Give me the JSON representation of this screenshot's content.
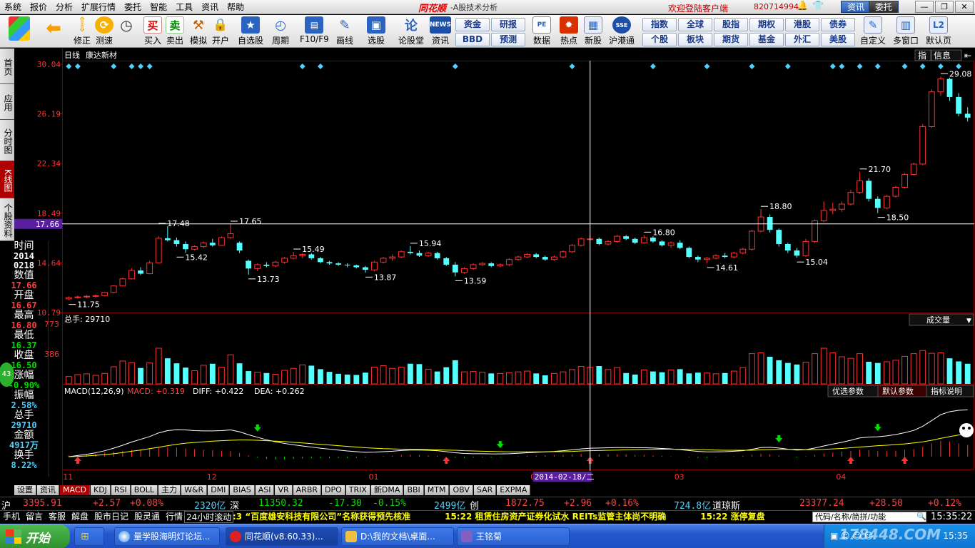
{
  "menubar": {
    "items": [
      "系统",
      "报价",
      "分析",
      "扩展行情",
      "委托",
      "智能",
      "工具",
      "资讯",
      "帮助"
    ],
    "app_logo": "同花顺",
    "app_subtitle": "-A股技术分析",
    "welcome": "欢迎登陆客户端",
    "account": "820714994",
    "btn_news": "资讯",
    "btn_trade": "委托"
  },
  "toolbar": {
    "buttons": [
      "修正",
      "测速",
      "买入",
      "卖出",
      "模拟",
      "开户",
      "自选股",
      "周期",
      "F10/F9",
      "画线",
      "选股",
      "论股堂",
      "资讯",
      "数据",
      "热点",
      "新股",
      "沪港通",
      "自定义",
      "多窗口",
      "默认页"
    ],
    "icon_buy": "买",
    "icon_sell": "卖",
    "icon_news": "NEWS",
    "grid_buttons_a": [
      "资金",
      "研报",
      "BBD",
      "预测"
    ],
    "grid_buttons_b": [
      "指数",
      "全球",
      "股指",
      "期权",
      "港股",
      "债券",
      "个股",
      "板块",
      "期货",
      "基金",
      "外汇",
      "美股"
    ]
  },
  "sidebar": {
    "tabs": [
      "首页",
      "应用",
      "分时图",
      "K线图",
      "个股资料"
    ]
  },
  "info_panel": {
    "time_label": "时间",
    "time_year": "2014",
    "time_date": "0218",
    "value_label": "数值",
    "value": "17.66",
    "open_label": "开盘",
    "open": "16.67",
    "high_label": "最高",
    "high": "16.80",
    "low_label": "最低",
    "low": "16.37",
    "close_label": "收盘",
    "close": "16.50",
    "change_label": "涨幅",
    "change": "-0.90%",
    "amplitude_label": "振幅",
    "amplitude": "2.58%",
    "volume_label": "总手",
    "volume": "29710",
    "amount_label": "金额",
    "amount": "4917万",
    "turnover_label": "换手",
    "turnover": "8.22%",
    "bubble": "43"
  },
  "chart": {
    "period_label": "日线",
    "stock_name": "康达新材",
    "right_btn_a": "指",
    "right_btn_b": "信息",
    "price_ticks": [
      "30.04",
      "26.19",
      "22.34",
      "18.49",
      "17.66",
      "14.64",
      "10.79"
    ],
    "price_annotations": [
      {
        "idx": 0,
        "v": 11.75,
        "label": "11.75",
        "side": "low"
      },
      {
        "idx": 10,
        "v": 17.48,
        "label": "17.48",
        "side": "high"
      },
      {
        "idx": 12,
        "v": 15.42,
        "label": "15.42",
        "side": "low"
      },
      {
        "idx": 18,
        "v": 17.65,
        "label": "17.65",
        "side": "high"
      },
      {
        "idx": 20,
        "v": 13.73,
        "label": "13.73",
        "side": "low"
      },
      {
        "idx": 25,
        "v": 15.49,
        "label": "15.49",
        "side": "high"
      },
      {
        "idx": 33,
        "v": 13.87,
        "label": "13.87",
        "side": "low"
      },
      {
        "idx": 38,
        "v": 15.94,
        "label": "15.94",
        "side": "high"
      },
      {
        "idx": 43,
        "v": 13.59,
        "label": "13.59",
        "side": "low"
      },
      {
        "idx": 64,
        "v": 16.8,
        "label": "16.80",
        "side": "high"
      },
      {
        "idx": 71,
        "v": 14.61,
        "label": "14.61",
        "side": "low"
      },
      {
        "idx": 77,
        "v": 18.8,
        "label": "18.80",
        "side": "high"
      },
      {
        "idx": 81,
        "v": 15.04,
        "label": "15.04",
        "side": "low"
      },
      {
        "idx": 88,
        "v": 21.7,
        "label": "21.70",
        "side": "high"
      },
      {
        "idx": 90,
        "v": 18.5,
        "label": "18.50",
        "side": "low"
      },
      {
        "idx": 97,
        "v": 29.08,
        "label": "29.08",
        "side": "high"
      }
    ],
    "volume_label": "总手: 29710",
    "volume_ticks": [
      "773",
      "386"
    ],
    "volume_select": "成交量",
    "macd_label": "MACD(12,26,9)",
    "macd_value": "MACD: +0.319",
    "diff_value": "DIFF: +0.422",
    "dea_value": "DEA: +0.262",
    "macd_btn_a": "优选参数",
    "macd_btn_b": "默认参数",
    "macd_btn_c": "指标说明",
    "month_labels": [
      {
        "idx": 0,
        "t": "11"
      },
      {
        "idx": 16,
        "t": "12"
      },
      {
        "idx": 34,
        "t": "01"
      },
      {
        "idx": 52,
        "t": "02"
      },
      {
        "idx": 68,
        "t": "03"
      },
      {
        "idx": 86,
        "t": "04"
      }
    ],
    "crosshair_date": "2014-02-18/二",
    "crosshair_price": "17.66",
    "crosshair_idx": 58
  },
  "chart_data": {
    "type": "candlestick",
    "title": "康达新材",
    "ylim": [
      10.79,
      30.04
    ],
    "volume_ylim": [
      0,
      773
    ],
    "ohlc": [
      [
        11.85,
        12.05,
        11.75,
        11.95
      ],
      [
        11.95,
        12.1,
        11.85,
        12.0
      ],
      [
        12.0,
        12.15,
        11.9,
        12.05
      ],
      [
        12.05,
        12.2,
        11.95,
        12.1
      ],
      [
        12.1,
        12.4,
        12.05,
        12.35
      ],
      [
        12.35,
        12.9,
        12.3,
        12.85
      ],
      [
        12.85,
        13.5,
        12.8,
        13.4
      ],
      [
        13.4,
        14.2,
        13.35,
        14.05
      ],
      [
        14.05,
        14.3,
        13.7,
        13.8
      ],
      [
        13.8,
        14.8,
        13.75,
        14.65
      ],
      [
        14.65,
        16.7,
        14.6,
        16.55
      ],
      [
        16.55,
        17.48,
        16.3,
        16.4
      ],
      [
        16.4,
        16.6,
        15.9,
        16.1
      ],
      [
        16.1,
        16.3,
        15.42,
        15.7
      ],
      [
        15.7,
        16.0,
        15.6,
        15.9
      ],
      [
        15.9,
        16.3,
        15.8,
        16.2
      ],
      [
        16.2,
        16.5,
        15.9,
        16.0
      ],
      [
        16.0,
        16.7,
        15.95,
        16.6
      ],
      [
        16.6,
        17.65,
        16.5,
        16.9
      ],
      [
        16.2,
        16.3,
        15.4,
        15.6
      ],
      [
        14.8,
        14.9,
        13.73,
        14.2
      ],
      [
        14.2,
        14.6,
        14.0,
        14.5
      ],
      [
        14.5,
        14.7,
        14.3,
        14.4
      ],
      [
        14.4,
        14.8,
        14.3,
        14.7
      ],
      [
        14.7,
        15.1,
        14.6,
        15.0
      ],
      [
        15.0,
        15.49,
        14.9,
        15.2
      ],
      [
        15.2,
        15.4,
        15.0,
        15.3
      ],
      [
        15.3,
        15.4,
        14.9,
        15.0
      ],
      [
        15.0,
        15.1,
        14.6,
        14.7
      ],
      [
        14.7,
        14.8,
        14.5,
        14.6
      ],
      [
        14.6,
        14.7,
        14.4,
        14.5
      ],
      [
        14.5,
        14.6,
        14.3,
        14.45
      ],
      [
        14.45,
        14.5,
        14.2,
        14.3
      ],
      [
        14.3,
        14.4,
        13.87,
        14.1
      ],
      [
        14.1,
        14.8,
        14.0,
        14.7
      ],
      [
        14.7,
        15.1,
        14.6,
        15.0
      ],
      [
        15.0,
        15.3,
        14.8,
        15.1
      ],
      [
        15.1,
        15.6,
        15.0,
        15.5
      ],
      [
        15.5,
        15.94,
        15.3,
        15.4
      ],
      [
        15.4,
        15.6,
        15.1,
        15.2
      ],
      [
        15.2,
        15.5,
        15.1,
        15.4
      ],
      [
        15.4,
        15.5,
        14.9,
        15.0
      ],
      [
        15.0,
        15.1,
        14.4,
        14.5
      ],
      [
        14.5,
        14.7,
        13.59,
        13.9
      ],
      [
        13.9,
        14.3,
        13.8,
        14.2
      ],
      [
        14.2,
        14.6,
        14.1,
        14.5
      ],
      [
        14.5,
        14.7,
        14.4,
        14.6
      ],
      [
        14.6,
        14.7,
        14.3,
        14.4
      ],
      [
        14.4,
        14.6,
        14.3,
        14.5
      ],
      [
        14.5,
        15.0,
        14.4,
        14.9
      ],
      [
        14.9,
        15.2,
        14.8,
        15.1
      ],
      [
        15.1,
        15.4,
        15.0,
        15.3
      ],
      [
        15.3,
        15.4,
        15.0,
        15.1
      ],
      [
        15.1,
        15.2,
        14.8,
        14.9
      ],
      [
        14.9,
        15.2,
        14.8,
        15.1
      ],
      [
        15.1,
        15.6,
        15.0,
        15.5
      ],
      [
        15.5,
        16.1,
        15.4,
        16.0
      ],
      [
        16.0,
        16.6,
        15.9,
        16.5
      ],
      [
        16.5,
        16.8,
        16.37,
        16.5
      ],
      [
        16.5,
        16.6,
        16.0,
        16.1
      ],
      [
        16.1,
        16.4,
        16.0,
        16.3
      ],
      [
        16.3,
        16.8,
        16.2,
        16.7
      ],
      [
        16.7,
        16.8,
        16.4,
        16.5
      ],
      [
        16.5,
        16.6,
        16.1,
        16.2
      ],
      [
        16.2,
        16.8,
        16.1,
        16.6
      ],
      [
        16.6,
        16.7,
        16.2,
        16.3
      ],
      [
        16.3,
        16.4,
        15.9,
        16.0
      ],
      [
        16.0,
        16.3,
        15.8,
        16.2
      ],
      [
        16.2,
        16.4,
        15.7,
        15.8
      ],
      [
        15.8,
        15.9,
        15.0,
        15.1
      ],
      [
        15.1,
        15.2,
        14.7,
        14.9
      ],
      [
        14.9,
        15.1,
        14.61,
        15.0
      ],
      [
        15.0,
        15.3,
        14.9,
        15.2
      ],
      [
        15.2,
        15.4,
        15.0,
        15.1
      ],
      [
        15.1,
        15.5,
        15.0,
        15.4
      ],
      [
        15.4,
        15.8,
        15.3,
        15.7
      ],
      [
        15.7,
        17.2,
        15.6,
        17.1
      ],
      [
        17.1,
        18.8,
        17.0,
        18.2
      ],
      [
        18.2,
        18.4,
        17.0,
        17.2
      ],
      [
        17.2,
        17.3,
        15.9,
        16.1
      ],
      [
        16.1,
        16.2,
        15.4,
        15.6
      ],
      [
        15.6,
        15.8,
        15.04,
        15.2
      ],
      [
        15.2,
        16.5,
        15.1,
        16.3
      ],
      [
        16.3,
        18.0,
        16.2,
        17.9
      ],
      [
        17.9,
        19.4,
        17.8,
        18.7
      ],
      [
        18.7,
        19.3,
        18.4,
        18.8
      ],
      [
        18.8,
        19.4,
        18.6,
        19.2
      ],
      [
        19.2,
        20.3,
        19.1,
        20.1
      ],
      [
        20.1,
        21.7,
        20.0,
        21.0
      ],
      [
        21.0,
        21.2,
        19.4,
        19.6
      ],
      [
        19.6,
        19.8,
        18.5,
        18.9
      ],
      [
        18.9,
        19.9,
        18.8,
        19.8
      ],
      [
        19.8,
        20.6,
        19.7,
        20.5
      ],
      [
        20.5,
        21.6,
        20.4,
        21.5
      ],
      [
        21.5,
        22.4,
        21.4,
        22.3
      ],
      [
        22.3,
        25.4,
        22.2,
        25.2
      ],
      [
        25.2,
        28.1,
        25.1,
        27.9
      ],
      [
        27.9,
        29.08,
        27.6,
        28.9
      ],
      [
        28.9,
        29.0,
        27.2,
        27.5
      ],
      [
        27.5,
        27.8,
        26.0,
        26.2
      ],
      [
        26.2,
        26.7,
        25.6,
        25.9
      ]
    ],
    "volume": [
      95,
      120,
      130,
      110,
      135,
      220,
      295,
      275,
      205,
      270,
      460,
      330,
      265,
      210,
      170,
      240,
      260,
      215,
      375,
      265,
      165,
      150,
      140,
      125,
      175,
      200,
      245,
      235,
      190,
      155,
      130,
      120,
      115,
      145,
      215,
      235,
      200,
      215,
      260,
      255,
      190,
      160,
      215,
      305,
      155,
      160,
      150,
      135,
      135,
      145,
      155,
      165,
      135,
      110,
      135,
      155,
      185,
      225,
      215,
      230,
      185,
      210,
      140,
      120,
      180,
      160,
      150,
      180,
      190,
      135,
      145,
      140,
      130,
      140,
      165,
      210,
      390,
      400,
      350,
      305,
      270,
      250,
      280,
      390,
      460,
      400,
      350,
      330,
      390,
      285,
      270,
      285,
      305,
      355,
      390,
      430,
      395,
      400,
      330,
      290,
      260
    ],
    "macd_hist": [
      0.05,
      0.07,
      0.1,
      0.14,
      0.18,
      0.22,
      0.26,
      0.3,
      0.32,
      0.34,
      0.4,
      0.42,
      0.4,
      0.36,
      0.33,
      0.3,
      0.28,
      0.26,
      0.24,
      0.16,
      0.06,
      -0.04,
      -0.1,
      -0.12,
      -0.12,
      -0.1,
      -0.08,
      -0.07,
      -0.07,
      -0.07,
      -0.06,
      -0.06,
      -0.05,
      -0.04,
      0.0,
      0.03,
      0.05,
      0.07,
      0.08,
      0.08,
      0.06,
      0.04,
      0.0,
      -0.04,
      -0.05,
      -0.04,
      -0.03,
      -0.03,
      -0.02,
      0.0,
      0.02,
      0.04,
      0.05,
      0.06,
      0.07,
      0.08,
      0.1,
      0.12,
      0.12,
      0.11,
      0.1,
      0.1,
      0.1,
      0.08,
      0.08,
      0.06,
      0.04,
      0.02,
      0.0,
      -0.03,
      -0.05,
      -0.04,
      -0.02,
      0.0,
      0.02,
      0.04,
      0.08,
      0.12,
      0.1,
      0.05,
      0.0,
      -0.03,
      0.02,
      0.08,
      0.14,
      0.18,
      0.22,
      0.26,
      0.3,
      0.28,
      0.24,
      0.24,
      0.26,
      0.3,
      0.34,
      0.44,
      0.58,
      0.7,
      0.66,
      0.58,
      0.52
    ],
    "diff_line": [
      0.0,
      0.05,
      0.1,
      0.17,
      0.26,
      0.37,
      0.5,
      0.64,
      0.76,
      0.88,
      1.04,
      1.14,
      1.18,
      1.17,
      1.14,
      1.13,
      1.13,
      1.14,
      1.17,
      1.09,
      0.96,
      0.85,
      0.74,
      0.65,
      0.58,
      0.52,
      0.47,
      0.42,
      0.37,
      0.33,
      0.29,
      0.25,
      0.22,
      0.19,
      0.2,
      0.22,
      0.24,
      0.27,
      0.29,
      0.29,
      0.28,
      0.26,
      0.22,
      0.17,
      0.14,
      0.13,
      0.13,
      0.12,
      0.12,
      0.13,
      0.15,
      0.17,
      0.19,
      0.21,
      0.23,
      0.26,
      0.3,
      0.34,
      0.37,
      0.38,
      0.39,
      0.4,
      0.4,
      0.39,
      0.39,
      0.38,
      0.36,
      0.34,
      0.31,
      0.27,
      0.23,
      0.21,
      0.21,
      0.22,
      0.24,
      0.26,
      0.32,
      0.4,
      0.41,
      0.38,
      0.33,
      0.29,
      0.31,
      0.38,
      0.47,
      0.55,
      0.63,
      0.72,
      0.82,
      0.86,
      0.87,
      0.91,
      0.97,
      1.05,
      1.15,
      1.33,
      1.58,
      1.84,
      1.97,
      2.03,
      2.05
    ],
    "dea_line": [
      0.0,
      0.01,
      0.03,
      0.06,
      0.09,
      0.13,
      0.18,
      0.24,
      0.29,
      0.35,
      0.41,
      0.48,
      0.54,
      0.59,
      0.62,
      0.65,
      0.68,
      0.7,
      0.72,
      0.73,
      0.73,
      0.72,
      0.7,
      0.68,
      0.66,
      0.63,
      0.6,
      0.57,
      0.54,
      0.51,
      0.48,
      0.45,
      0.42,
      0.39,
      0.37,
      0.35,
      0.34,
      0.33,
      0.32,
      0.32,
      0.31,
      0.3,
      0.29,
      0.28,
      0.26,
      0.25,
      0.24,
      0.23,
      0.22,
      0.21,
      0.21,
      0.21,
      0.21,
      0.21,
      0.22,
      0.22,
      0.23,
      0.25,
      0.26,
      0.27,
      0.28,
      0.29,
      0.3,
      0.31,
      0.32,
      0.32,
      0.33,
      0.33,
      0.32,
      0.32,
      0.31,
      0.3,
      0.29,
      0.28,
      0.28,
      0.28,
      0.28,
      0.3,
      0.31,
      0.32,
      0.32,
      0.32,
      0.31,
      0.31,
      0.32,
      0.34,
      0.36,
      0.39,
      0.42,
      0.45,
      0.48,
      0.5,
      0.53,
      0.56,
      0.6,
      0.65,
      0.72,
      0.8,
      0.88,
      0.95,
      1.0
    ],
    "buy_arrows": [
      1,
      42,
      58,
      87,
      93
    ],
    "sell_arrows": [
      21,
      48,
      79,
      90
    ],
    "signal_diamonds": [
      0,
      1,
      5,
      7,
      8,
      9,
      26,
      28,
      43,
      56,
      65,
      71,
      76,
      80,
      85,
      86,
      88,
      90,
      93,
      95,
      97,
      99
    ]
  },
  "ind_tabs": [
    "设置",
    "资讯",
    "MACD",
    "KDJ",
    "RSI",
    "BOLL",
    "主力",
    "W&R",
    "DMI",
    "BIAS",
    "ASI",
    "VR",
    "ARBR",
    "DPO",
    "TRIX",
    "新DMA",
    "BBI",
    "MTM",
    "OBV",
    "SAR",
    "EXPMA"
  ],
  "ticker": {
    "sh_label": "沪",
    "sh_index": "3395.91",
    "sh_chg": "+2.57",
    "sh_pct": "+0.08%",
    "sh_amt": "2320亿",
    "sz_label": "深",
    "sz_index": "11350.32",
    "sz_chg": "-17.30",
    "sz_pct": "-0.15%",
    "sz_amt": "2499亿",
    "cy_label": "创",
    "cy_index": "1872.75",
    "cy_chg": "+2.96",
    "cy_pct": "+0.16%",
    "cy_amt": "724.8亿",
    "dj_label": "道琼斯",
    "dj_index": "23377.24",
    "dj_chg": "+28.50",
    "dj_pct": "+0.12%"
  },
  "statusbar": {
    "buttons": [
      "手机",
      "留言",
      "客服",
      "解盘",
      "股市日记",
      "股灵通",
      "行情",
      "24小时滚动"
    ],
    "news": ":3 “百度雄安科技有限公司”名称获得预先核准　　　　15:22 租赁住房资产证券化试水 REITs监管主体尚不明确　　　　15:22 涨停复盘",
    "search_placeholder": "代码/名称/简拼/功能",
    "clock": "15:35:22"
  },
  "taskbar": {
    "start": "开始",
    "items": [
      "量学股海明灯论坛...",
      "同花顺(v8.60.33)...",
      "D:\\我的文档\\桌面...",
      "王铭菊"
    ],
    "tray_time": "15:35",
    "watermark": "178448.COM"
  }
}
